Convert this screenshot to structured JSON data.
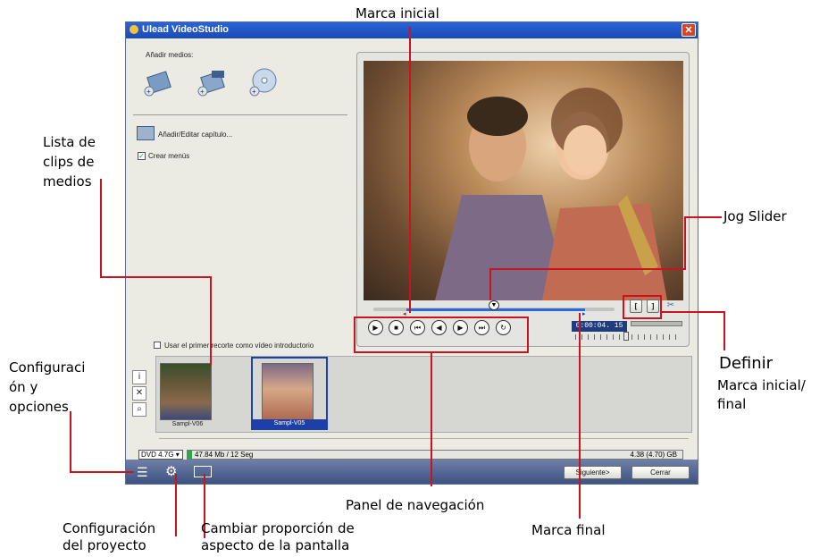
{
  "window": {
    "title": "Ulead VideoStudio",
    "close_glyph": "✕",
    "add_media_label": "Añadir medios:",
    "add_media_icons": [
      "add-video-icon",
      "add-vob-icon",
      "add-disc-icon"
    ],
    "add_chapter_label": "Añadir/Editar capítulo...",
    "create_menus_label": "Crear menús",
    "create_menus_checked": true,
    "intro_checkbox_label": "Usar el primer recorte como vídeo introductorio",
    "intro_checked": false,
    "timecode": "0:00:04. 15",
    "trim_start_glyph": "[",
    "trim_end_glyph": "]",
    "clips": [
      {
        "label": "Sampl-V06",
        "selected": false
      },
      {
        "label": "Sampl-V05",
        "selected": true
      }
    ],
    "disc_select": "DVD 4.7G",
    "disc_usage": "47.84 Mb / 12 Seg",
    "disc_capacity": "4.38 (4.70) GB",
    "next_button": "Siguiente>",
    "close_button": "Cerrar",
    "accent_color": "#2b63d6"
  },
  "callouts": {
    "marca_inicial": "Marca inicial",
    "lista_clips": [
      "Lista de",
      "clips de",
      "medios"
    ],
    "jog_slider": "Jog Slider",
    "configuracion": [
      "Configuraci",
      "ón y",
      "opciones"
    ],
    "definir": "Definir",
    "definir_sub": [
      "Marca inicial/",
      "final"
    ],
    "panel_navegacion": "Panel de navegación",
    "marca_final": "Marca final",
    "config_proyecto": [
      "Configuración",
      "del proyecto"
    ],
    "cambiar_proporcion": [
      "Cambiar proporción de",
      "aspecto de la pantalla"
    ]
  }
}
